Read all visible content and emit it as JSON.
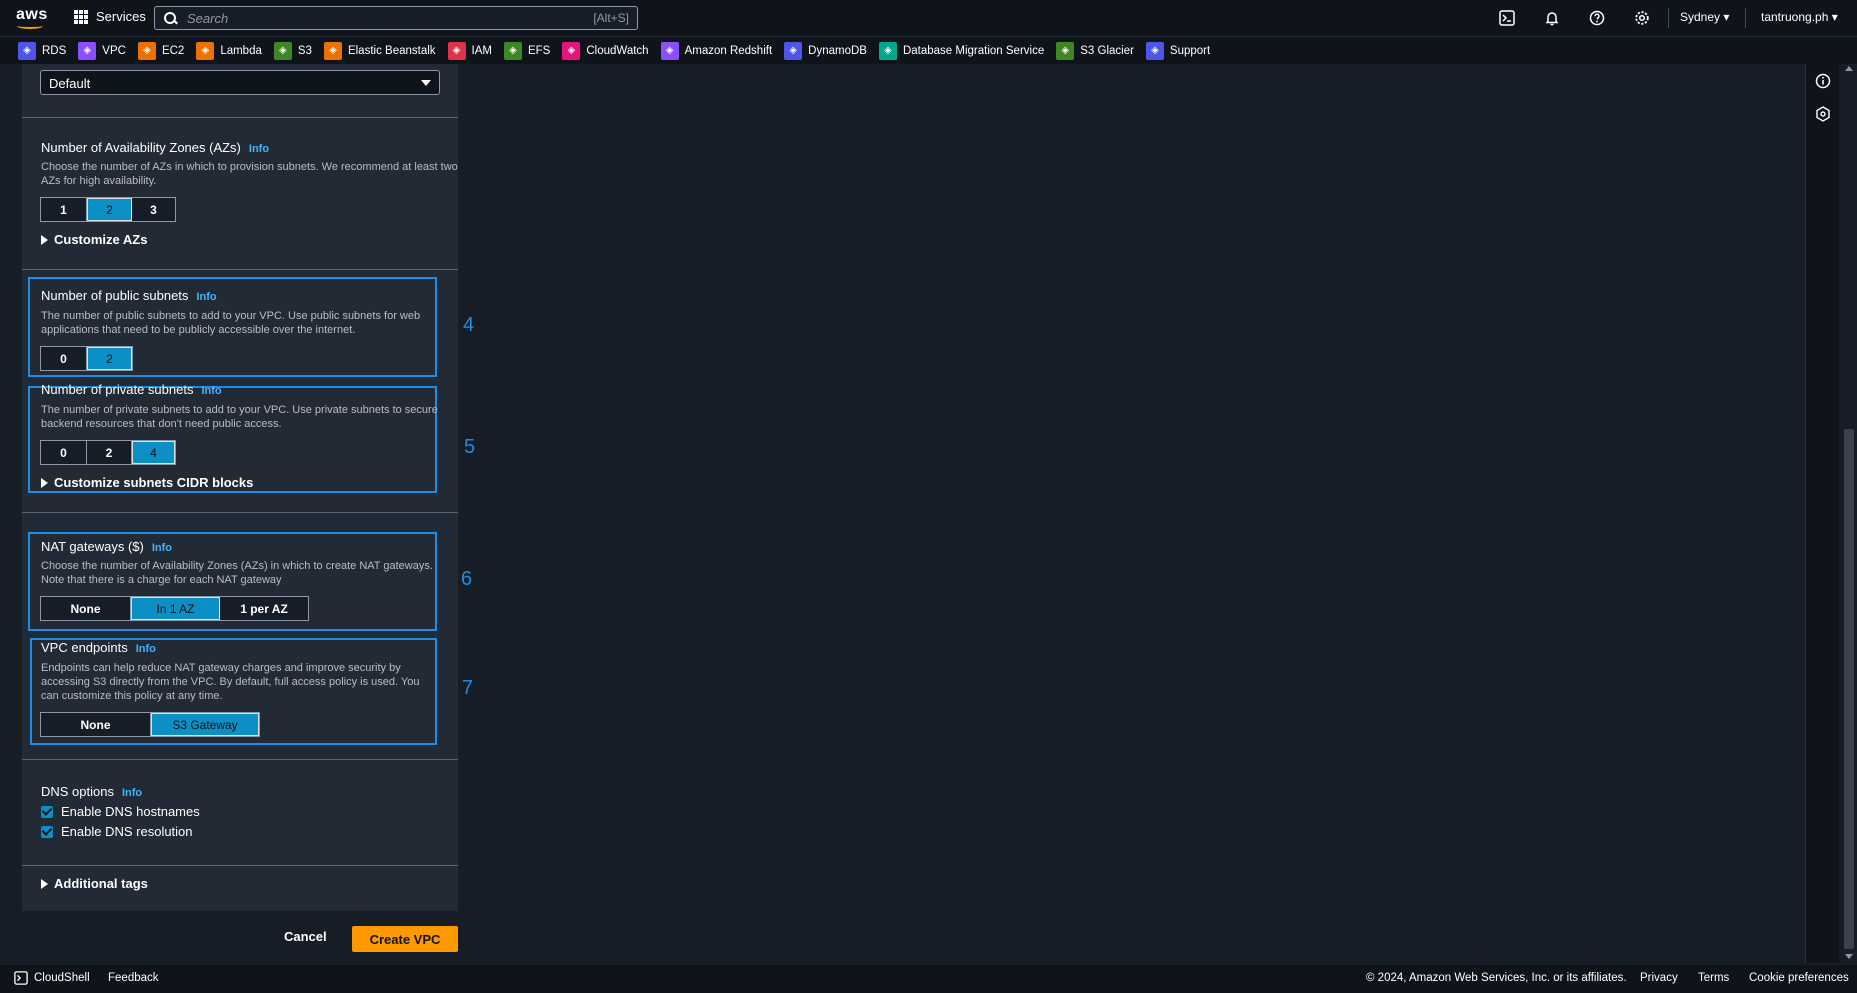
{
  "topnav": {
    "logo": "aws",
    "services_label": "Services",
    "search_placeholder": "Search",
    "search_shortcut": "[Alt+S]",
    "region": "Sydney",
    "account": "tantruong.ph"
  },
  "favorites": [
    {
      "label": "RDS",
      "color": "#4d56e6",
      "icon": "rds-icon"
    },
    {
      "label": "VPC",
      "color": "#8c4fff",
      "icon": "vpc-icon"
    },
    {
      "label": "EC2",
      "color": "#ed7100",
      "icon": "ec2-icon"
    },
    {
      "label": "Lambda",
      "color": "#ed7100",
      "icon": "lambda-icon"
    },
    {
      "label": "S3",
      "color": "#3f8624",
      "icon": "s3-icon"
    },
    {
      "label": "Elastic Beanstalk",
      "color": "#ed7100",
      "icon": "beanstalk-icon"
    },
    {
      "label": "IAM",
      "color": "#dd344c",
      "icon": "iam-icon"
    },
    {
      "label": "EFS",
      "color": "#3f8624",
      "icon": "efs-icon"
    },
    {
      "label": "CloudWatch",
      "color": "#e7157b",
      "icon": "cloudwatch-icon"
    },
    {
      "label": "Amazon Redshift",
      "color": "#8c4fff",
      "icon": "redshift-icon"
    },
    {
      "label": "DynamoDB",
      "color": "#4d56e6",
      "icon": "dynamodb-icon"
    },
    {
      "label": "Database Migration Service",
      "color": "#01a88d",
      "icon": "dms-icon"
    },
    {
      "label": "S3 Glacier",
      "color": "#3f8624",
      "icon": "glacier-icon"
    },
    {
      "label": "Support",
      "color": "#4d56e6",
      "icon": "support-icon"
    }
  ],
  "form": {
    "tenancy_value": "Default",
    "azs": {
      "label": "Number of Availability Zones (AZs)",
      "info": "Info",
      "desc": "Choose the number of AZs in which to provision subnets. We recommend at least two AZs for high availability.",
      "options": [
        "1",
        "2",
        "3"
      ],
      "selected": "2",
      "expander": "Customize AZs"
    },
    "public_subnets": {
      "label": "Number of public subnets",
      "info": "Info",
      "desc": "The number of public subnets to add to your VPC. Use public subnets for web applications that need to be publicly accessible over the internet.",
      "options": [
        "0",
        "2"
      ],
      "selected": "2",
      "step": "4"
    },
    "private_subnets": {
      "label": "Number of private subnets",
      "info": "Info",
      "desc": "The number of private subnets to add to your VPC. Use private subnets to secure backend resources that don't need public access.",
      "options": [
        "0",
        "2",
        "4"
      ],
      "selected": "4",
      "expander": "Customize subnets CIDR blocks",
      "step": "5"
    },
    "nat": {
      "label": "NAT gateways ($)",
      "info": "Info",
      "desc": "Choose the number of Availability Zones (AZs) in which to create NAT gateways. Note that there is a charge for each NAT gateway",
      "options": [
        "None",
        "In 1 AZ",
        "1 per AZ"
      ],
      "selected": "In 1 AZ",
      "step": "6"
    },
    "endpoints": {
      "label": "VPC endpoints",
      "info": "Info",
      "desc": "Endpoints can help reduce NAT gateway charges and improve security by accessing S3 directly from the VPC. By default, full access policy is used. You can customize this policy at any time.",
      "options": [
        "None",
        "S3 Gateway"
      ],
      "selected": "S3 Gateway",
      "step": "7"
    },
    "dns": {
      "label": "DNS options",
      "info": "Info",
      "hostnames": "Enable DNS hostnames",
      "resolution": "Enable DNS resolution"
    },
    "tags_expander": "Additional tags",
    "cancel": "Cancel",
    "create": "Create VPC"
  },
  "footer": {
    "cloudshell": "CloudShell",
    "feedback": "Feedback",
    "copyright": "© 2024, Amazon Web Services, Inc. or its affiliates.",
    "privacy": "Privacy",
    "terms": "Terms",
    "cookies": "Cookie preferences"
  }
}
